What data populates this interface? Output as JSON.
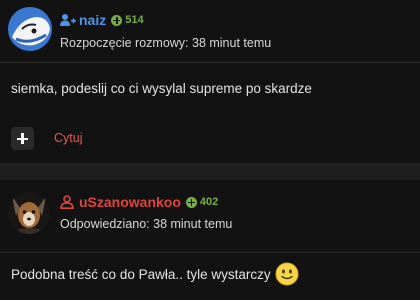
{
  "posts": [
    {
      "username": "naiz",
      "reputation": "514",
      "meta": "Rozpoczęcie rozmowy: 38 minut temu",
      "body": "siemka, podeslij co ci wysylal supreme po skardze",
      "quote_label": "Cytuj",
      "colors": {
        "username": "#4c95e8",
        "reputation": "#76b041"
      },
      "icons": {
        "user": "user-group-icon",
        "reputation": "plus-circle-icon",
        "action": "plus-icon"
      }
    },
    {
      "username": "uSzanowankoo",
      "reputation": "402",
      "meta": "Odpowiedziano: 38 minut temu",
      "body": "Podobna treść co do Pawła.. tyle wystarczy",
      "colors": {
        "username": "#e0443a",
        "reputation": "#76b041"
      },
      "icons": {
        "user": "user-outline-icon",
        "reputation": "plus-circle-icon",
        "emoji": "smiley-icon"
      }
    }
  ]
}
